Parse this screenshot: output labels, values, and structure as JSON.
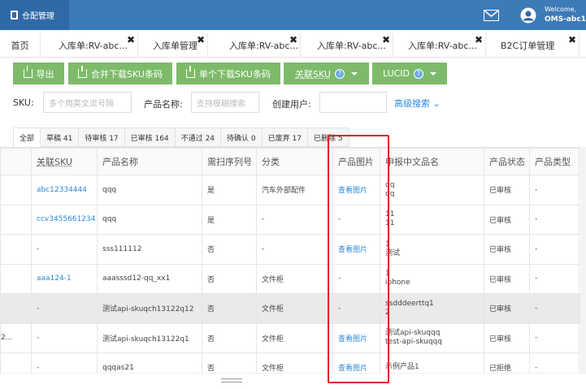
{
  "brand": {
    "title": "仓配管理"
  },
  "header": {
    "welcome": "Welcome,",
    "username": "OMS-abc1"
  },
  "tabs": [
    {
      "label": "首页"
    },
    {
      "label": "入库单:RV-abc..."
    },
    {
      "label": "入库单管理"
    },
    {
      "label": "入库单:RV-abc..."
    },
    {
      "label": "入库单:RV-abc..."
    },
    {
      "label": "入库单:RV-abc..."
    },
    {
      "label": "B2C订单管理"
    }
  ],
  "toolbar": {
    "export": "导出",
    "merge_download": "合并下载SKU条码",
    "single_download": "单个下载SKU条码",
    "link_sku": "关联SKU",
    "lucid": "LUCID"
  },
  "filters": {
    "sku_label": "SKU:",
    "sku_placeholder": "多个用英文逗号隔",
    "name_label": "产品名称:",
    "name_placeholder": "支持模糊搜索",
    "creator_label": "创建用户:",
    "advanced": "高级搜索"
  },
  "status_tabs": [
    {
      "label": "全部"
    },
    {
      "label": "草稿 41"
    },
    {
      "label": "待审核 17"
    },
    {
      "label": "已审核 164"
    },
    {
      "label": "不通过 24"
    },
    {
      "label": "待确认 0"
    },
    {
      "label": "已废弃 17"
    },
    {
      "label": "已删除 5"
    }
  ],
  "table": {
    "headers": [
      "关联SKU",
      "产品名称",
      "需扫序列号",
      "分类",
      "产品图片",
      "申报中文品名",
      "产品状态",
      "产品类型"
    ],
    "rows": [
      {
        "left": "",
        "sku": "abc12334444",
        "name": "qqq",
        "scan": "是",
        "category": "汽车外部配件",
        "image": "查看图片",
        "decl1": "qq",
        "decl2": "qq",
        "status": "已审核",
        "type": "-"
      },
      {
        "left": "",
        "sku": "ccv3455661234",
        "name": "qqq",
        "scan": "是",
        "category": "-",
        "image": "-",
        "decl1": "11",
        "decl2": "11",
        "status": "已审核",
        "type": "-"
      },
      {
        "left": "",
        "sku": "-",
        "name": "sss111112",
        "scan": "否",
        "category": "-",
        "image": "查看图片",
        "decl1": "1",
        "decl2": "测试",
        "status": "已审核",
        "type": "-"
      },
      {
        "left": "",
        "sku": "aaa124-1",
        "name": "aaasssd12-qq_xx1",
        "scan": "否",
        "category": "文件柜",
        "image": "-",
        "decl1": "1",
        "decl2": "iphone",
        "status": "已审核",
        "type": "-"
      },
      {
        "left": "",
        "sku": "-",
        "name": "测试api-skuqch13122q12",
        "scan": "否",
        "category": "文件柜",
        "image": "-",
        "decl1": "ssdddeerttq1",
        "decl2": "2",
        "status": "已审核",
        "type": "-"
      },
      {
        "left": "2...",
        "sku": "-",
        "name": "测试api-skuqch13122q1",
        "scan": "否",
        "category": "文件柜",
        "image": "查看图片",
        "decl1": "测试api-skuqqq",
        "decl2": "test-api-skuqqq",
        "status": "已审核",
        "type": "-"
      },
      {
        "left": "",
        "sku": "-",
        "name": "qqqas21",
        "scan": "否",
        "category": "文件柜",
        "image": "查看图片",
        "decl1": "示例产品1",
        "decl2": "",
        "status": "已拒绝",
        "type": "-"
      }
    ]
  },
  "colors": {
    "header_bg": "#3d7ab8",
    "button_green": "#7dbb6a",
    "link_blue": "#2c8ad8",
    "highlight_red": "#e02424"
  }
}
